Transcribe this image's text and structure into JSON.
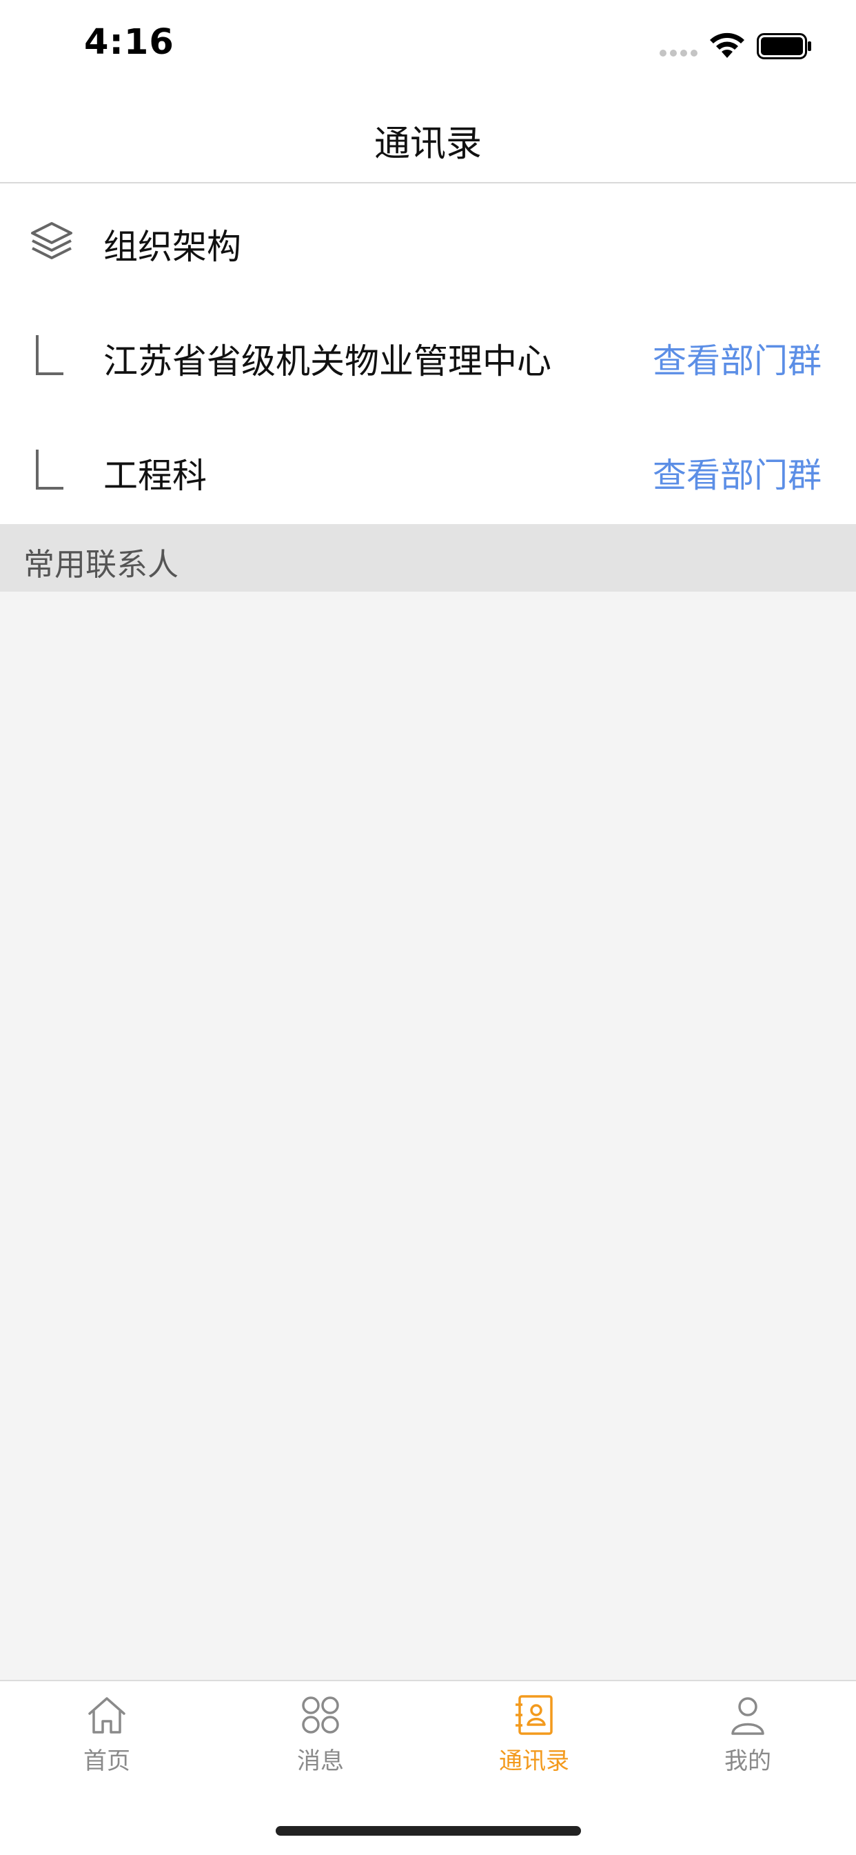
{
  "status_bar": {
    "time": "4:16"
  },
  "header": {
    "title": "通讯录"
  },
  "org": {
    "root_label": "组织架构",
    "items": [
      {
        "label": "江苏省省级机关物业管理中心",
        "action": "查看部门群"
      },
      {
        "label": "工程科",
        "action": "查看部门群"
      }
    ]
  },
  "frequent_contacts": {
    "header": "常用联系人"
  },
  "tab_bar": {
    "tabs": [
      {
        "label": "首页",
        "icon": "home-icon"
      },
      {
        "label": "消息",
        "icon": "message-grid-icon"
      },
      {
        "label": "通讯录",
        "icon": "contacts-book-icon",
        "active": true
      },
      {
        "label": "我的",
        "icon": "person-icon"
      }
    ],
    "active_color": "#f39a1d",
    "inactive_color": "#8a8a8a"
  },
  "colors": {
    "link": "#5b8ee6",
    "section_header_bg": "#e3e3e3",
    "page_bg": "#f4f4f4"
  }
}
